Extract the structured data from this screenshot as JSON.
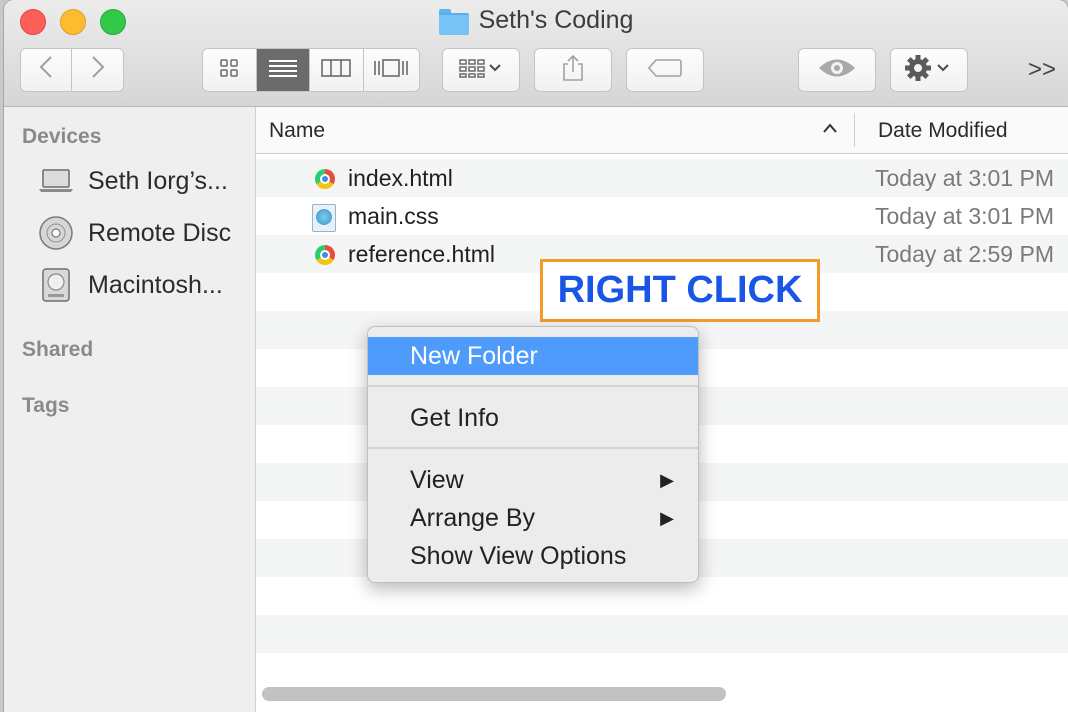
{
  "window": {
    "title": "Seth's Coding"
  },
  "toolbar": {
    "back_icon": "chevron-left-icon",
    "forward_icon": "chevron-right-icon",
    "view_modes": [
      "icon-view",
      "list-view",
      "column-view",
      "cover-flow-view"
    ],
    "active_view": "list-view",
    "more_label": ">>"
  },
  "sidebar": {
    "sections": [
      {
        "header": "Devices",
        "items": [
          {
            "label": "Seth Iorg’s...",
            "icon": "laptop-icon"
          },
          {
            "label": "Remote Disc",
            "icon": "disc-icon"
          },
          {
            "label": "Macintosh...",
            "icon": "hard-drive-icon"
          }
        ]
      },
      {
        "header": "Shared",
        "items": []
      },
      {
        "header": "Tags",
        "items": []
      }
    ]
  },
  "columns": {
    "name": "Name",
    "date": "Date Modified"
  },
  "files": [
    {
      "name": "index.html",
      "date": "Today at 3:01 PM",
      "icon": "chrome-html-icon"
    },
    {
      "name": "main.css",
      "date": "Today at 3:01 PM",
      "icon": "css-file-icon"
    },
    {
      "name": "reference.html",
      "date": "Today at 2:59 PM",
      "icon": "chrome-html-icon"
    }
  ],
  "callout": {
    "text": "RIGHT CLICK"
  },
  "context_menu": {
    "items": [
      {
        "label": "New Folder",
        "selected": true
      },
      {
        "label": "Get Info"
      },
      {
        "label": "View",
        "submenu": true,
        "arrow": "▶"
      },
      {
        "label": "Arrange By",
        "submenu": true,
        "arrow": "▶"
      },
      {
        "label": "Show View Options"
      }
    ]
  },
  "colors": {
    "menu_highlight": "#4f9bfc",
    "callout_border": "#f39a2b",
    "callout_text": "#1a56e6"
  }
}
